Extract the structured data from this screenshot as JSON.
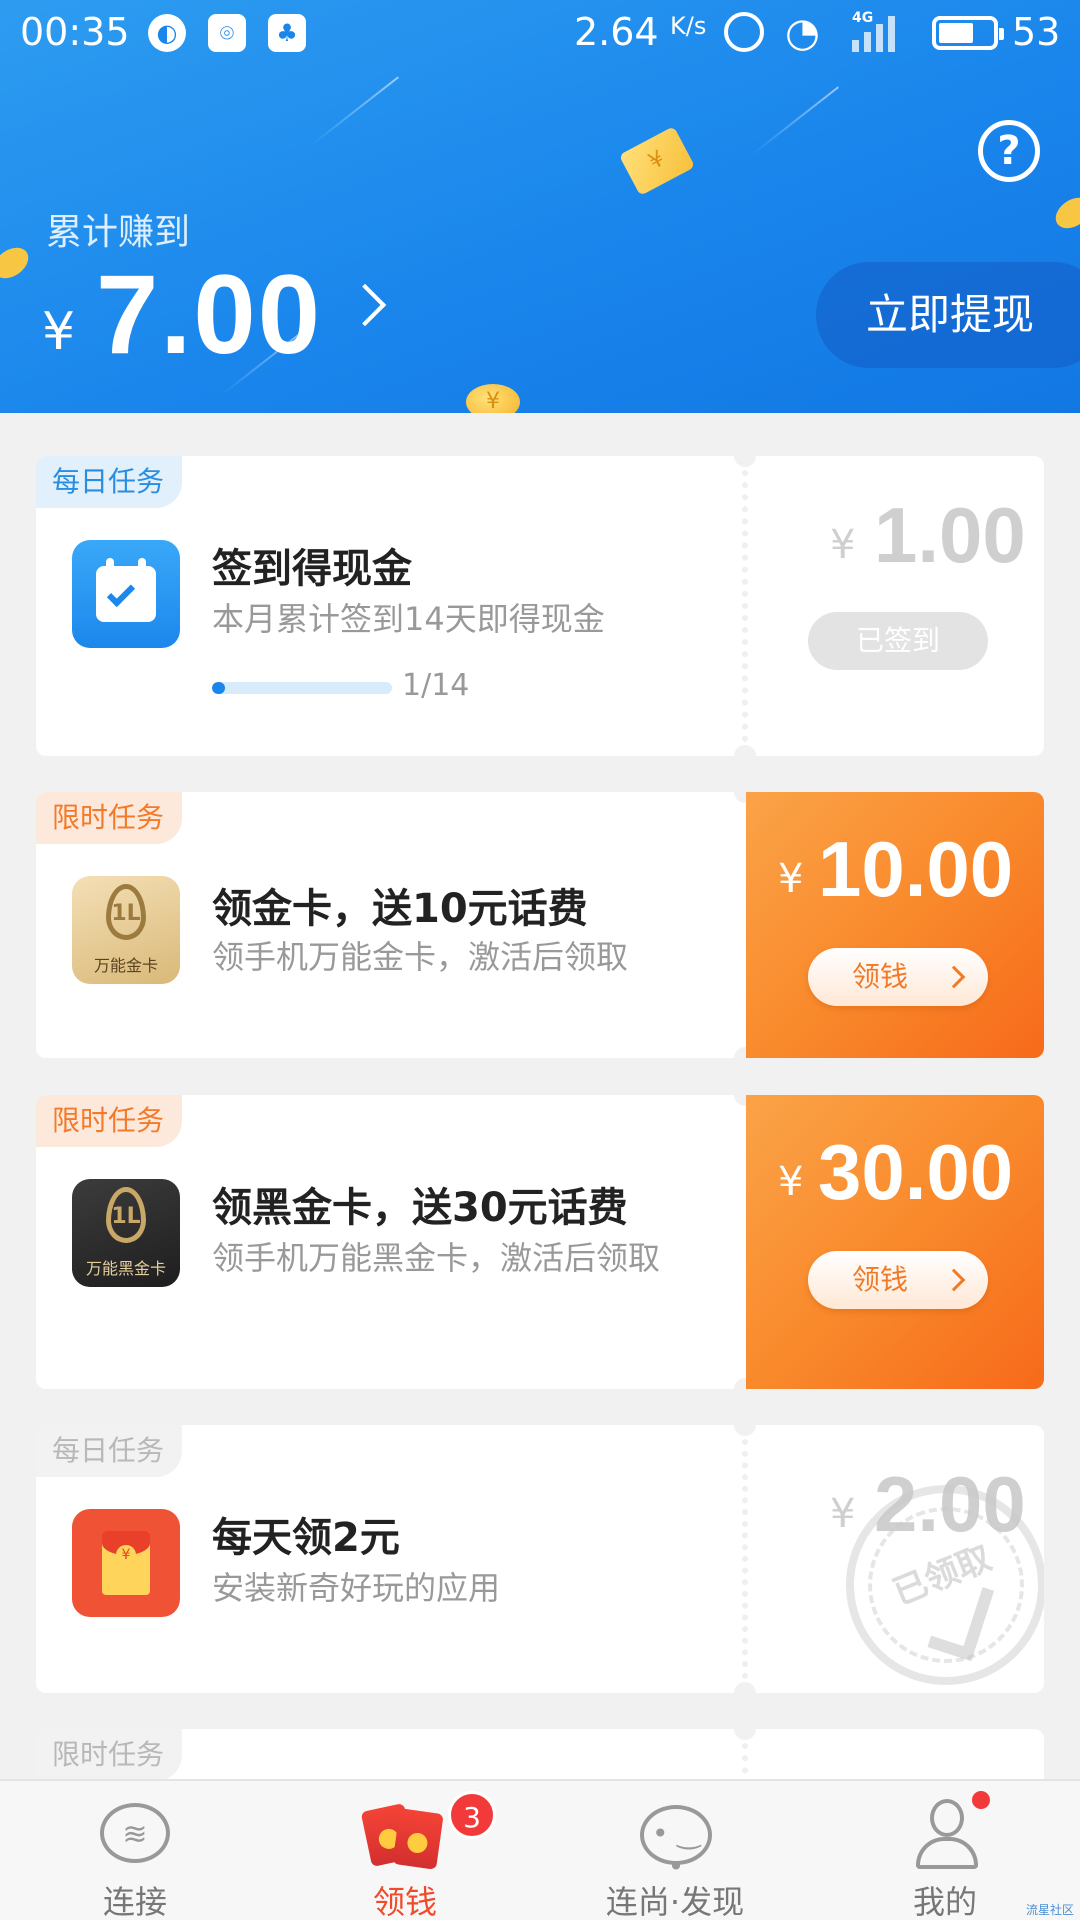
{
  "status_bar": {
    "time": "00:35",
    "speed": "2.64",
    "speed_unit": "K/s",
    "network": "4G",
    "battery_level": "53",
    "icons": [
      "browser-icon",
      "wifi-key-icon",
      "qq-icon",
      "alarm-icon",
      "wifi-icon",
      "signal-icon",
      "battery-icon"
    ]
  },
  "header": {
    "earned_label": "累计赚到",
    "currency": "¥",
    "earned_amount": "7.00",
    "withdraw_label": "立即提现",
    "help_label": "?",
    "colors": {
      "gradient_start": "#2d9cf0",
      "gradient_end": "#1277e3"
    }
  },
  "tasks": [
    {
      "tag": "每日任务",
      "title": "签到得现金",
      "desc": "本月累计签到14天即得现金",
      "progress_text": "1/14",
      "progress_fraction": 0.0714,
      "currency": "¥",
      "amount": "1.00",
      "button": "已签到",
      "icon": "calendar-check-icon",
      "state": "done"
    },
    {
      "tag": "限时任务",
      "title": "领金卡，送10元话费",
      "desc": "领手机万能金卡，激活后领取",
      "icon_label": "万能金卡",
      "currency": "¥",
      "amount": "10.00",
      "button": "领钱",
      "icon": "gold-card-icon",
      "state": "claimable"
    },
    {
      "tag": "限时任务",
      "title": "领黑金卡，送30元话费",
      "desc": "领手机万能黑金卡，激活后领取",
      "icon_label": "万能黑金卡",
      "currency": "¥",
      "amount": "30.00",
      "button": "领钱",
      "icon": "black-gold-card-icon",
      "state": "claimable"
    },
    {
      "tag": "每日任务",
      "title": "每天领2元",
      "desc": "安装新奇好玩的应用",
      "currency": "¥",
      "amount": "2.00",
      "stamp": "已领取",
      "icon": "red-envelope-icon",
      "state": "claimed"
    },
    {
      "tag": "限时任务"
    }
  ],
  "tabbar": {
    "tabs": [
      {
        "label": "连接",
        "icon": "wifi-icon"
      },
      {
        "label": "领钱",
        "icon": "red-envelope-icon",
        "badge": "3",
        "active": true
      },
      {
        "label": "连尚·发现",
        "icon": "planet-icon"
      },
      {
        "label": "我的",
        "icon": "person-icon",
        "dot": true
      }
    ]
  },
  "watermark": "流星社区"
}
